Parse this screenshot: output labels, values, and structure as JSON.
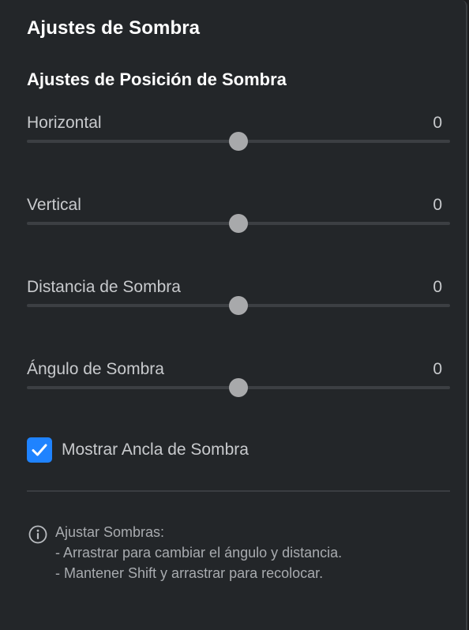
{
  "panel": {
    "title": "Ajustes de Sombra",
    "section_title": "Ajustes de Posición de Sombra"
  },
  "sliders": [
    {
      "label": "Horizontal",
      "value": "0",
      "fraction": 0.5
    },
    {
      "label": "Vertical",
      "value": "0",
      "fraction": 0.5
    },
    {
      "label": "Distancia de Sombra",
      "value": "0",
      "fraction": 0.5
    },
    {
      "label": "Ángulo de Sombra",
      "value": "0",
      "fraction": 0.5
    }
  ],
  "checkbox": {
    "label": "Mostrar Ancla de Sombra",
    "checked": true
  },
  "info": {
    "icon": "info-icon",
    "heading": "Ajustar Sombras:",
    "line1": "- Arrastrar para cambiar el ángulo y distancia.",
    "line2": "- Mantener Shift y arrastrar para recolocar."
  },
  "colors": {
    "accent": "#1f83ff",
    "background": "#232629",
    "thumb": "#a8a9ab"
  }
}
